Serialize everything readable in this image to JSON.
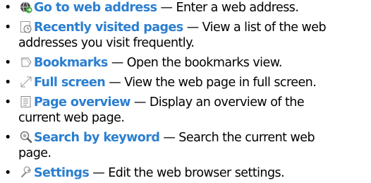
{
  "colors": {
    "link": "#2b7fd0",
    "text": "#000000"
  },
  "bullet": "•",
  "dash": "—",
  "items": [
    {
      "icon": "globe-go-icon",
      "title": "Go to web address",
      "description": "Enter a web address."
    },
    {
      "icon": "recent-pages-icon",
      "title": "Recently visited pages",
      "description": "View a list of the web",
      "continuation": "addresses you visit frequently."
    },
    {
      "icon": "bookmarks-icon",
      "title": "Bookmarks",
      "description": "Open the bookmarks view."
    },
    {
      "icon": "full-screen-icon",
      "title": "Full screen",
      "description": "View the web page in full screen."
    },
    {
      "icon": "page-overview-icon",
      "title": "Page overview",
      "description": "Display an overview of the",
      "continuation": "current web page."
    },
    {
      "icon": "search-keyword-icon",
      "title": "Search by keyword",
      "description": "Search the current web",
      "continuation": "page."
    },
    {
      "icon": "settings-icon",
      "title": "Settings",
      "description": "Edit the web browser settings."
    }
  ]
}
